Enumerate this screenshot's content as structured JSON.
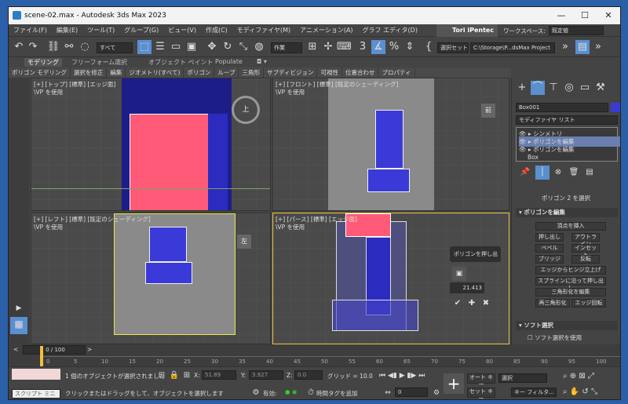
{
  "window": {
    "title": "scene-02.max - Autodesk 3ds Max 2023",
    "minimize": "—",
    "maximize": "☐",
    "close": "✕"
  },
  "menu": [
    "ファイル(F)",
    "編集(E)",
    "ツール(T)",
    "グループ(G)",
    "ビュー(V)",
    "作成(C)",
    "モディファイヤ(M)",
    "アニメーション(A)",
    "グラフ エディタ(D)"
  ],
  "user": {
    "name": "Tori iPentec",
    "workspace_label": "ワークスペース:",
    "workspace_value": "既定値"
  },
  "toolbar": {
    "filter": "すべて",
    "refcoord": "作業",
    "named_sel": "選択セット",
    "project": "C:\\Storage\\P...dsMax Project"
  },
  "ribbon_tabs": [
    "モデリング",
    "フリーフォーム",
    "選択",
    "オブジェクト ペイント",
    "Populate"
  ],
  "ribbon_items": [
    "ポリゴン モデリング",
    "選択を修正",
    "編集",
    "ジオメトリ(すべて)",
    "ポリゴン",
    "ループ",
    "三角形",
    "サブディビジョン",
    "可視性",
    "位置合わせ",
    "プロパティ"
  ],
  "viewports": {
    "top": {
      "label": "[+] [トップ] [標準] [エッジ面]",
      "sub": "\\VP を使用",
      "cube": "上"
    },
    "front": {
      "label": "[+] [フロント] [標準] [既定のシェーディング]",
      "sub": "\\VP を使用",
      "cube": "前"
    },
    "left": {
      "label": "[+] [レフト] [標準] [既定のシェーディング]",
      "sub": "\\VP を使用",
      "cube": "左"
    },
    "persp": {
      "label": "[+] [パース] [標準] [エッジ面]",
      "sub": "\\VP を使用",
      "caddy_title": "ポリゴンを押し出し",
      "caddy_value": "21.413"
    }
  },
  "panel": {
    "object_name": "Box001",
    "modifier_list": "モディファイヤ リスト",
    "stack": [
      "シンメトリ",
      "ポリゴンを編集",
      "ポリゴンを編集",
      "Box"
    ],
    "selected_info": "ポリゴン 2 を選択",
    "edit_poly_title": "ポリゴンを編集",
    "buttons": [
      "頂点を挿入",
      "押し出し",
      "アウトライン",
      "ベベル",
      "インセット",
      "ブリッジ",
      "反転",
      "エッジからヒンジ立上げ",
      "スプラインに沿って押し出し",
      "三角形化を編集",
      "再三角形化",
      "エッジ回転"
    ],
    "soft_title": "ソフト選択",
    "soft_use": "ソフト選択を使用"
  },
  "timeline": {
    "frame": "0 / 100",
    "ticks": [
      "0",
      "5",
      "10",
      "15",
      "20",
      "25",
      "30",
      "35",
      "40",
      "45",
      "50",
      "55",
      "60",
      "65",
      "70",
      "75",
      "80",
      "85",
      "90",
      "95",
      "100"
    ]
  },
  "status": {
    "script": "スクリプト ミニ リス",
    "selected": "1 個のオブジェクトが選択されました",
    "hint": "クリックまたはドラッグをして、オブジェクトを選択します",
    "x_label": "X:",
    "x": "51.89",
    "y_label": "Y:",
    "y": "3.927",
    "z_label": "Z:",
    "z": "0.0",
    "grid": "グリッド = 10.0",
    "enabled": "有効:",
    "add_time_tag": "時間タグを追加",
    "auto_key": "オート キー",
    "set_key": "セット キー",
    "selection": "選択",
    "key_filter": "キー フィルタ...",
    "frame_value": "0"
  },
  "colors": {
    "accent": "#f0c040",
    "selected_face": "#ff5a78",
    "poly_blue": "#3a3ad8",
    "title_bar": "#f3f3f3"
  }
}
